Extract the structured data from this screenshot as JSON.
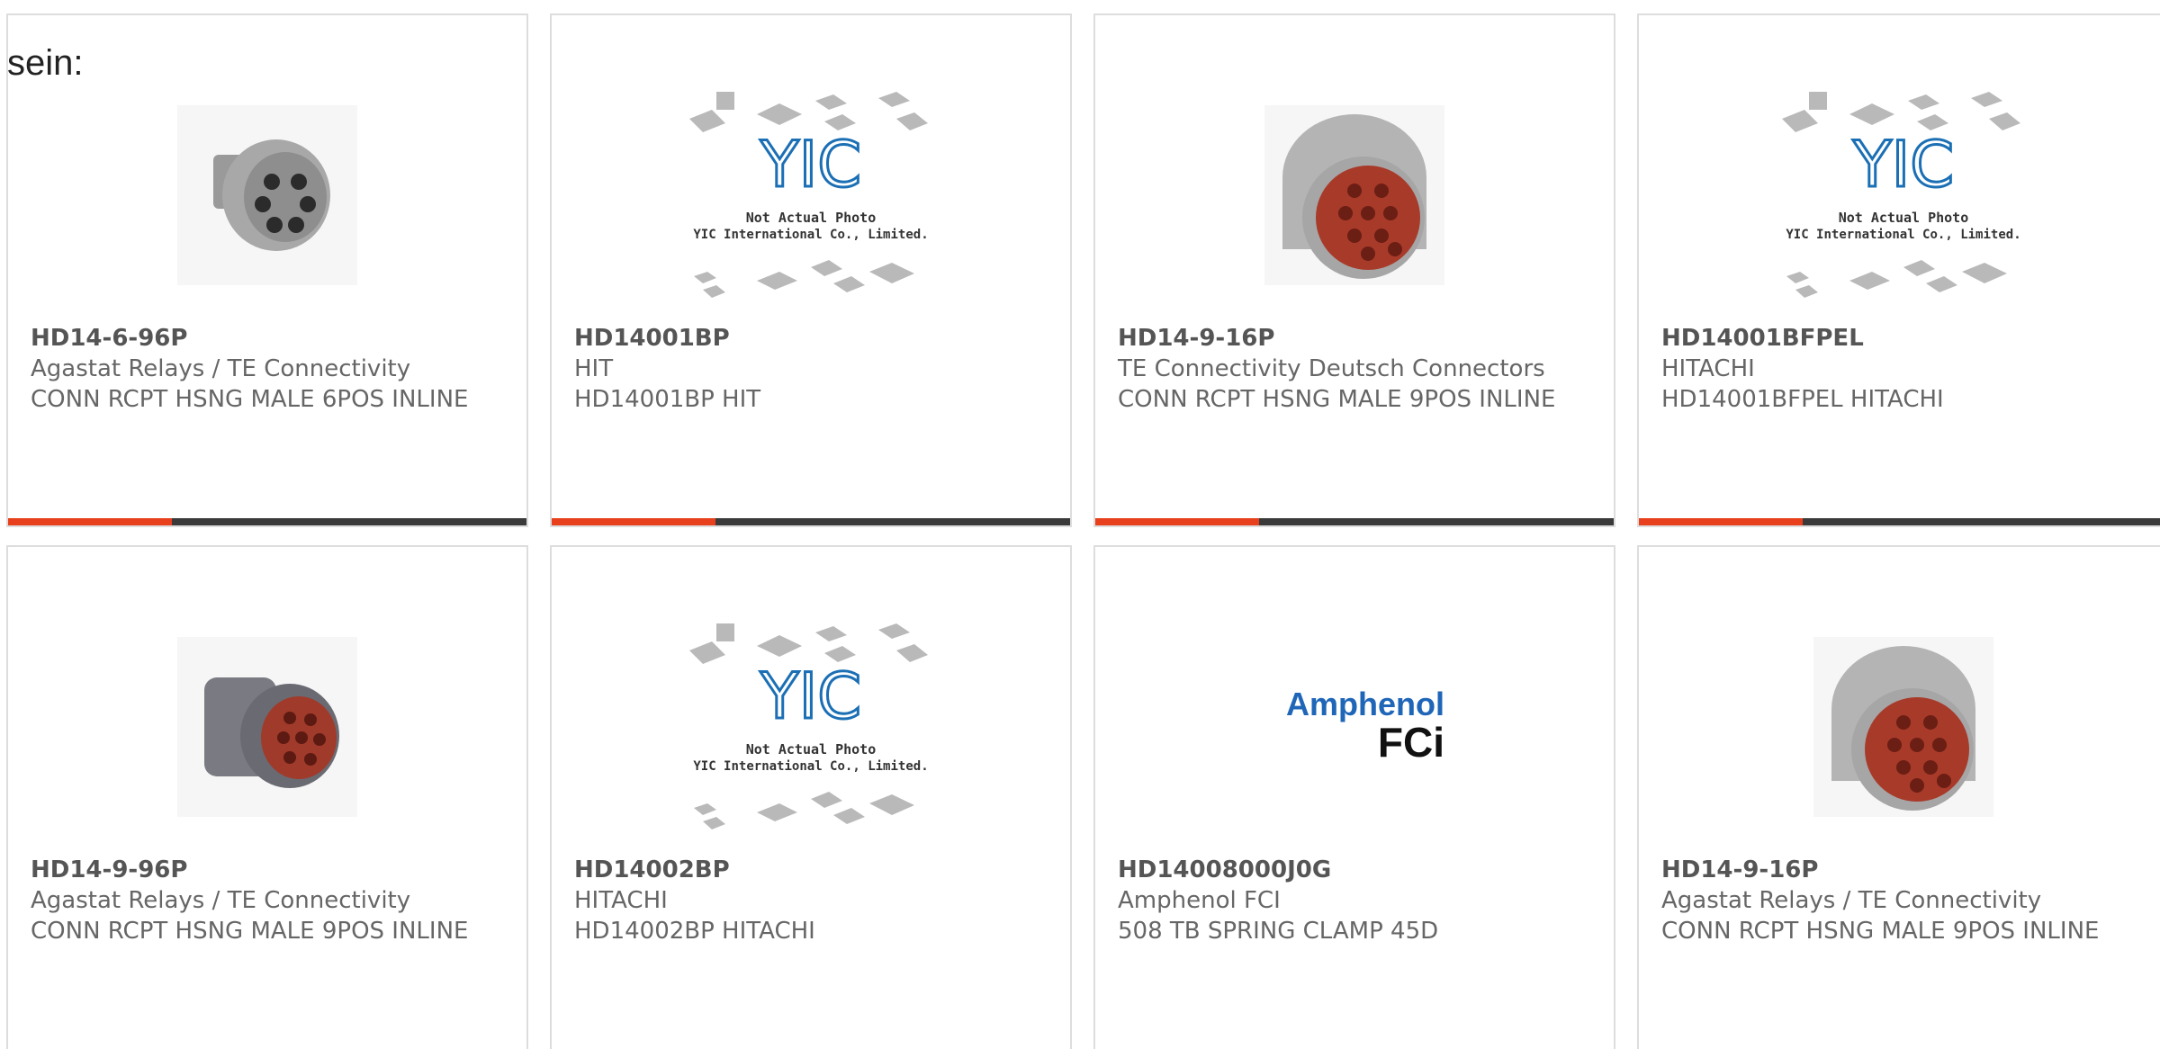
{
  "colors": {
    "accent": "#e8401c",
    "dark": "#3a3a3a"
  },
  "intro_text": "sein:",
  "products": [
    {
      "part": "HD14-6-96P",
      "manufacturer": "Agastat Relays / TE Connectivity",
      "description": "CONN RCPT HSNG MALE 6POS INLINE",
      "image": "connector-6pos-gray",
      "has_bar": true
    },
    {
      "part": "HD14001BP",
      "manufacturer": "HIT",
      "description": "HD14001BP HIT",
      "image": "yic-placeholder",
      "has_bar": true,
      "placeholder": {
        "line1": "Not Actual Photo",
        "line2": "YIC International Co., Limited."
      }
    },
    {
      "part": "HD14-9-16P",
      "manufacturer": "TE Connectivity Deutsch Connectors",
      "description": "CONN RCPT HSNG MALE 9POS INLINE",
      "image": "connector-9pos-red",
      "has_bar": true
    },
    {
      "part": "HD14001BFPEL",
      "manufacturer": "HITACHI",
      "description": "HD14001BFPEL HITACHI",
      "image": "yic-placeholder",
      "has_bar": true,
      "placeholder": {
        "line1": "Not Actual Photo",
        "line2": "YIC International Co., Limited."
      }
    },
    {
      "part": "HD14-9-96P",
      "manufacturer": "Agastat Relays / TE Connectivity",
      "description": "CONN RCPT HSNG MALE 9POS INLINE",
      "image": "connector-9pos-red-dark",
      "has_bar": false
    },
    {
      "part": "HD14002BP",
      "manufacturer": "HITACHI",
      "description": "HD14002BP HITACHI",
      "image": "yic-placeholder",
      "has_bar": false,
      "placeholder": {
        "line1": "Not Actual Photo",
        "line2": "YIC International Co., Limited."
      }
    },
    {
      "part": "HD14008000J0G",
      "manufacturer": "Amphenol FCI",
      "description": "508 TB SPRING CLAMP 45D",
      "image": "amphenol-fci-logo",
      "has_bar": false,
      "logo": {
        "line1": "Amphenol",
        "line2": "FCi"
      }
    },
    {
      "part": "HD14-9-16P",
      "manufacturer": "Agastat Relays / TE Connectivity",
      "description": "CONN RCPT HSNG MALE 9POS INLINE",
      "image": "connector-9pos-red",
      "has_bar": false
    }
  ]
}
